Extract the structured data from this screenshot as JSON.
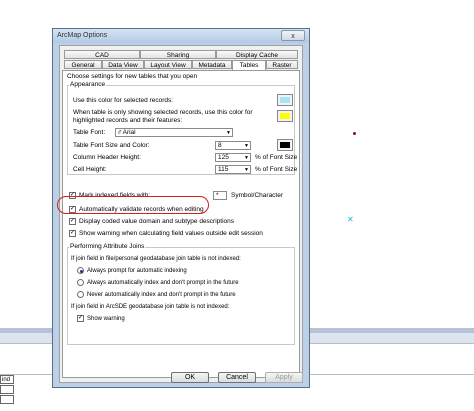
{
  "dialog": {
    "title": "ArcMap Options",
    "close_label": "x",
    "tabs_row1": [
      "CAD",
      "Sharing",
      "Display Cache"
    ],
    "tabs_row2": [
      "General",
      "Data View",
      "Layout View",
      "Metadata",
      "Tables",
      "Raster"
    ],
    "active_tab": "Tables",
    "intro": "Choose settings for new tables that you open",
    "appearance": {
      "label": "Appearance",
      "selected_color_label": "Use this color for selected records:",
      "selected_color": "#a8e4f6",
      "highlight_label_1": "When table is only showing selected records, use this color for",
      "highlight_label_2": "highlighted records and their features:",
      "highlight_color": "#ffff00",
      "font_label": "Table Font:",
      "font_value": "Arial",
      "size_label": "Table Font Size and Color:",
      "size_value": "8",
      "font_color": "#000000",
      "header_height_label": "Column Header Height:",
      "header_height_value": "125",
      "cell_height_label": "Cell Height:",
      "cell_height_value": "115",
      "unit_label": "% of Font Size"
    },
    "mark_indexed_label": "Mark indexed fields with:",
    "mark_symbol": "*",
    "symbol_label": "Symbol/Character",
    "validate_label": "Automatically validate records when editing",
    "coded_label": "Display coded value domain and subtype descriptions",
    "warning_label": "Show warning when calculating field values outside edit session",
    "joins": {
      "label": "Performing Attribute Joins",
      "file_label": "If join field in file/personal geodatabase join table is not indexed:",
      "options": [
        "Always prompt for automatic indexing",
        "Always automatically index and don't prompt in the future",
        "Never automatically index and don't prompt in the future"
      ],
      "sde_label": "If join field in ArcSDE geodatabase join table is not indexed:",
      "show_warning_label": "Show warning"
    },
    "buttons": {
      "ok": "OK",
      "cancel": "Cancel",
      "apply": "Apply"
    }
  },
  "background": {
    "cell_label": "ind"
  }
}
